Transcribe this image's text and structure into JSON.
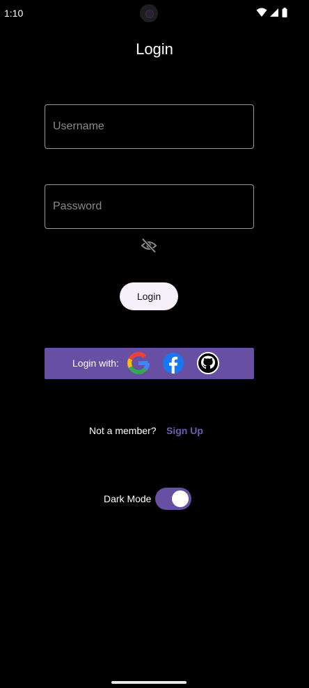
{
  "status_bar": {
    "time": "1:10",
    "icons": [
      "wifi-icon",
      "signal-icon",
      "battery-icon"
    ]
  },
  "title": "Login",
  "username": {
    "placeholder": "Username",
    "value": ""
  },
  "password": {
    "placeholder": "Password",
    "value": "",
    "visibility_icon": "visibility-off-icon"
  },
  "login_button": "Login",
  "social": {
    "label": "Login with:",
    "providers": [
      "google-icon",
      "facebook-icon",
      "github-icon"
    ]
  },
  "signup": {
    "prompt": "Not a member?",
    "link": "Sign Up"
  },
  "dark_mode": {
    "label": "Dark Mode",
    "enabled": true
  },
  "colors": {
    "background": "#000000",
    "accent": "#6750a4",
    "link": "#6f5bb0",
    "button_bg": "#f6f1fb"
  }
}
